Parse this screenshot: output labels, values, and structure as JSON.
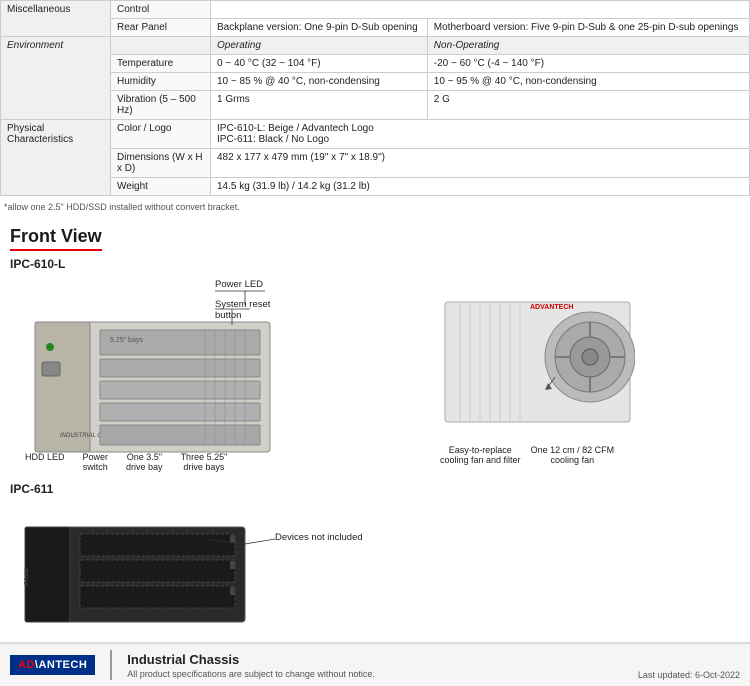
{
  "specs": {
    "note": "*allow one 2.5\" HDD/SSD installed without convert bracket.",
    "categories": [
      {
        "name": "Miscellaneous",
        "rows": [
          {
            "label": "Control",
            "values": [
              "",
              ""
            ],
            "span_label": true
          },
          {
            "label": "Rear Panel",
            "col1": "Backplane version: One 9-pin D-Sub opening",
            "col2": "Motherboard version: Five 9-pin D-Sub & one 25-pin D-sub openings"
          }
        ]
      },
      {
        "name": "Environment",
        "rows": [
          {
            "label": "",
            "col1": "Operating",
            "col2": "Non-Operating",
            "is_header": true
          },
          {
            "label": "Temperature",
            "col1": "0 ~ 40 °C (32 ~ 104 °F)",
            "col2": "-20 ~ 60 °C (-4 ~ 140 °F)"
          },
          {
            "label": "Humidity",
            "col1": "10 ~ 85 % @ 40 °C, non-condensing",
            "col2": "10 ~ 95 % @ 40 °C, non-condensing"
          },
          {
            "label": "Vibration (5 – 500 Hz)",
            "col1": "1 Grms",
            "col2": "2 G"
          }
        ]
      },
      {
        "name": "Physical Characteristics",
        "rows": [
          {
            "label": "Color / Logo",
            "col1": "IPC-610-L: Beige / Advantech Logo\nIPC-611: Black / No Logo",
            "col2": ""
          },
          {
            "label": "Dimensions (W x H x D)",
            "col1": "482 x 177 x 479 mm (19\" x 7\" x 18.9\")",
            "col2": ""
          },
          {
            "label": "Weight",
            "col1": "14.5 kg (31.9 lb) / 14.2 kg (31.2 lb)",
            "col2": ""
          }
        ]
      }
    ]
  },
  "frontview": {
    "title": "Front View",
    "models": {
      "ipc610l": {
        "label": "IPC-610-L",
        "callouts_top": [
          {
            "id": "power-led",
            "text": "Power LED"
          },
          {
            "id": "system-reset",
            "text": "System reset\nbutton"
          }
        ],
        "callouts_bottom": [
          {
            "id": "hdd-led",
            "text": "HDD LED"
          },
          {
            "id": "power-switch",
            "text": "Power\nswitch"
          },
          {
            "id": "drive-35",
            "text": "One 3.5\"\ndrive bay"
          },
          {
            "id": "drive-525",
            "text": "Three 5.25\"\ndrive bays"
          }
        ],
        "right_callouts": [
          {
            "id": "fan-filter",
            "text": "Easy-to-replace\ncooling fan and filter"
          },
          {
            "id": "fan-cfm",
            "text": "One 12 cm / 82 CFM\ncooling fan"
          }
        ]
      },
      "ipc611": {
        "label": "IPC-611",
        "callouts": [
          {
            "id": "devices",
            "text": "Devices not included"
          }
        ]
      }
    }
  },
  "footer": {
    "brand": "AD⧺NTECH",
    "brand_display": "ADVANTECH",
    "title": "Industrial Chassis",
    "note": "All product specifications are subject to change without notice.",
    "date": "Last updated: 6-Oct-2022"
  }
}
